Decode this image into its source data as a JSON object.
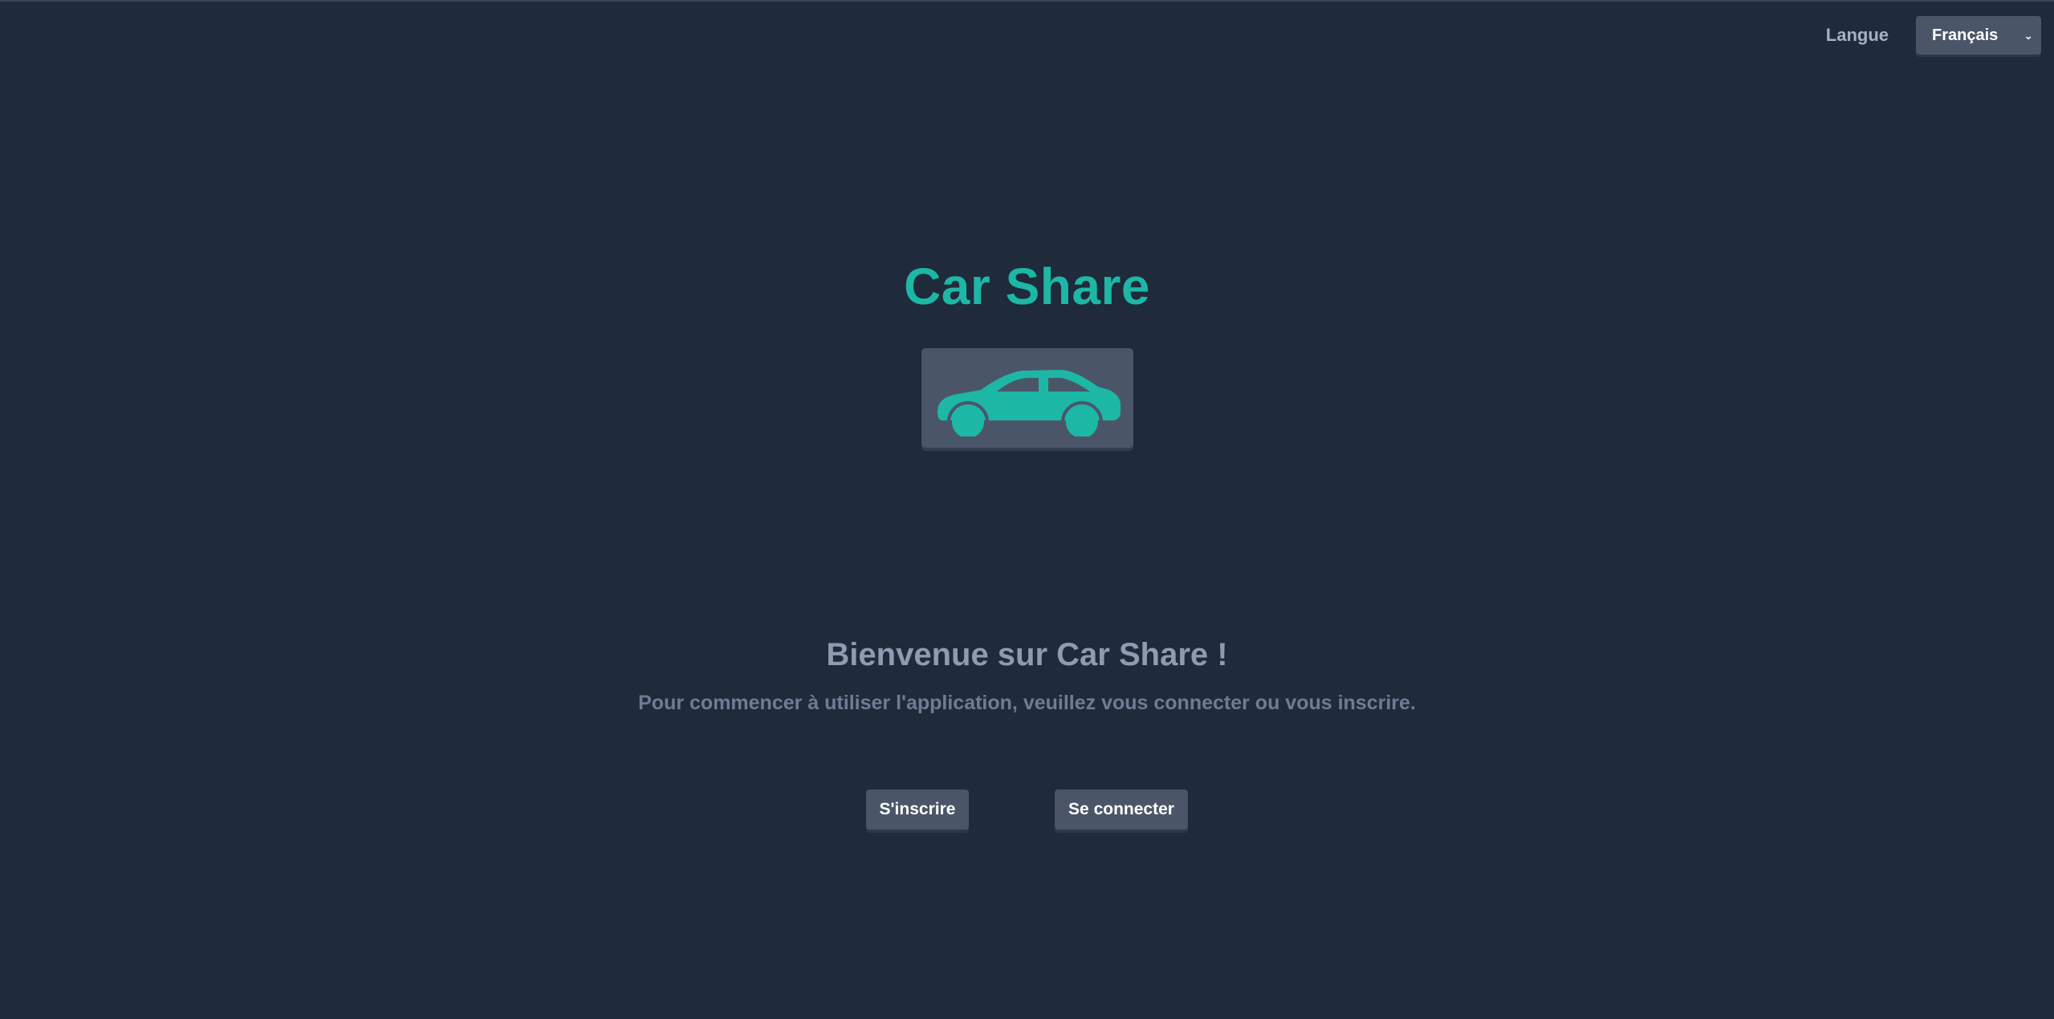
{
  "header": {
    "language_label": "Langue",
    "language_select": {
      "selected": "Français"
    }
  },
  "brand": {
    "title": "Car Share",
    "icon": "car-icon",
    "accent_color": "#1db7a6"
  },
  "main": {
    "welcome_title": "Bienvenue sur Car Share !",
    "subtitle": "Pour commencer à utiliser l'application, veuillez vous connecter ou vous inscrire.",
    "signup_label": "S'inscrire",
    "login_label": "Se connecter"
  },
  "colors": {
    "background": "#1f2a3b",
    "tile": "#4a5668",
    "text_muted": "#8e9bb0"
  }
}
